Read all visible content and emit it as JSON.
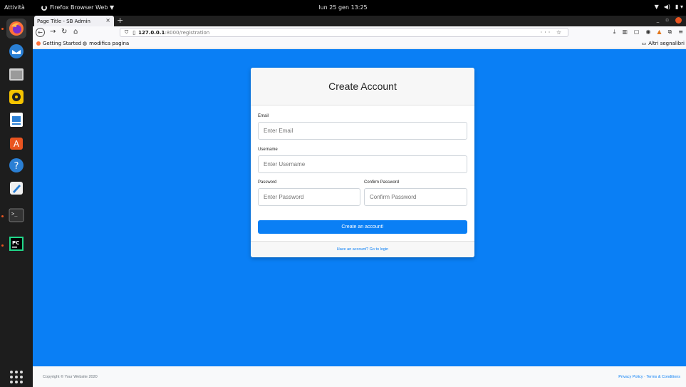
{
  "system": {
    "activities": "Attività",
    "app_menu": "Firefox Browser Web ▼",
    "clock": "lun 25 gen  13:25"
  },
  "browser": {
    "tab_title": "Page Title - SB Admin",
    "tab_close": "×",
    "new_tab": "+",
    "url_host": "127.0.0.1",
    "url_path": ":8000/registration",
    "url_actions": "··· ☆",
    "bookmarks": {
      "getting_started": "Getting Started",
      "modifica": "modifica pagina",
      "other": "Altri segnalibri"
    }
  },
  "form": {
    "title": "Create Account",
    "email_label": "Email",
    "email_placeholder": "Enter Email",
    "username_label": "Username",
    "username_placeholder": "Enter Username",
    "password_label": "Password",
    "password_placeholder": "Enter Password",
    "confirm_label": "Confirm Password",
    "confirm_placeholder": "Confirm Password",
    "submit": "Create an account!",
    "login_link": "Have an account? Go to login"
  },
  "footer": {
    "copyright": "Copyright © Your Website 2020",
    "privacy": "Privacy Policy",
    "separator": " · ",
    "terms": "Terms & Conditions"
  },
  "colors": {
    "primary": "#0a7ff5",
    "ubuntu_orange": "#e95420"
  }
}
